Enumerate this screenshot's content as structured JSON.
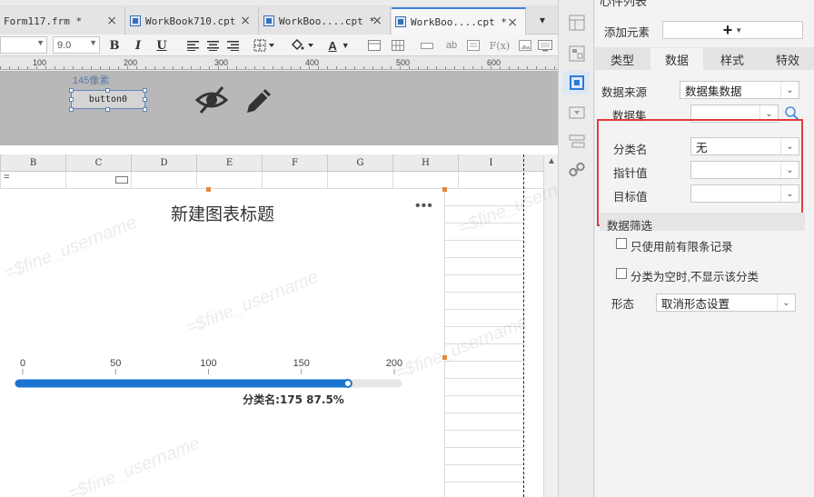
{
  "tabs": [
    {
      "label": "Form117.frm *",
      "active": false
    },
    {
      "label": "WorkBook710.cpt",
      "active": false
    },
    {
      "label": "WorkBoo....cpt *",
      "active": false
    },
    {
      "label": "WorkBoo....cpt *",
      "active": true
    }
  ],
  "toolbar": {
    "font_size": "9.0",
    "bold": "B",
    "italic": "I",
    "underline": "U",
    "text_color": "A",
    "formula": "F(x)",
    "abbrev": "ab"
  },
  "ruler": {
    "marks": [
      "100",
      "200",
      "300",
      "400",
      "500",
      "600"
    ]
  },
  "form": {
    "size_hint": "145像素",
    "button_label": "button0"
  },
  "sheet": {
    "columns": [
      "B",
      "C",
      "D",
      "E",
      "F",
      "G",
      "H",
      "I"
    ],
    "first_cell": "="
  },
  "chart_data": {
    "type": "gauge-bar",
    "title": "新建图表标题",
    "axis_ticks": [
      0,
      50,
      100,
      150,
      200
    ],
    "xlim": [
      0,
      200
    ],
    "value": 175,
    "percent": 87.5,
    "value_label": "分类名:175 87.5%",
    "bar_color": "#1a73d1",
    "track_color": "#e6e6e6"
  },
  "watermark": "=$fine_username",
  "chart_more": "•••",
  "panel": {
    "header_text": "心件列表",
    "add_element_label": "添加元素",
    "add_symbol": "+",
    "tabs": [
      "类型",
      "数据",
      "样式",
      "特效"
    ],
    "active_tab": "数据",
    "data_source_label": "数据来源",
    "data_source_value": "数据集数据",
    "dataset_label": "数据集",
    "dataset_value": "",
    "category_label": "分类名",
    "category_value": "无",
    "pointer_label": "指针值",
    "pointer_value": "",
    "target_label": "目标值",
    "target_value": "",
    "filter_header": "数据筛选",
    "checkbox1": "只使用前有限条记录",
    "checkbox2": "分类为空时,不显示该分类",
    "shape_label": "形态",
    "shape_value": "取消形态设置"
  }
}
